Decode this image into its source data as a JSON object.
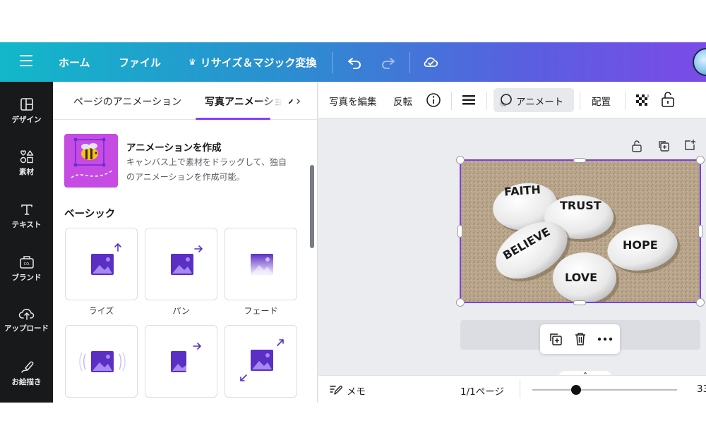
{
  "header": {
    "nav": {
      "home": "ホーム",
      "file": "ファイル",
      "resize": "リサイズ＆マジック変換"
    },
    "colors": {
      "gradient_start": "#12b8c9",
      "gradient_end": "#7b4be8"
    },
    "icons": [
      "menu-icon",
      "undo-icon",
      "redo-icon",
      "cloud-saved-icon",
      "crown-icon"
    ]
  },
  "rail": {
    "items": [
      {
        "label": "デザイン",
        "icon": "design-icon"
      },
      {
        "label": "素材",
        "icon": "elements-icon"
      },
      {
        "label": "テキスト",
        "icon": "text-icon"
      },
      {
        "label": "ブランド",
        "icon": "brand-icon"
      },
      {
        "label": "アップロード",
        "icon": "upload-icon"
      },
      {
        "label": "お絵描き",
        "icon": "draw-icon"
      }
    ]
  },
  "panel": {
    "tabs": [
      {
        "label": "ページのアニメーション"
      },
      {
        "label": "写真アニメーション"
      }
    ],
    "promo": {
      "title": "アニメーションを作成",
      "desc_line1": "キャンバス上で素材をドラッグして、独自",
      "desc_line2": "のアニメーションを作成可能。"
    },
    "section": "ベーシック",
    "cards": [
      {
        "label": "ライズ"
      },
      {
        "label": "パン"
      },
      {
        "label": "フェード"
      },
      {
        "label": ""
      },
      {
        "label": ""
      },
      {
        "label": ""
      }
    ]
  },
  "toolbar": {
    "edit_photo": "写真を編集",
    "flip": "反転",
    "animate": "アニメート",
    "position": "配置",
    "accent": "#8b3dff"
  },
  "canvas": {
    "stones": [
      "FAITH",
      "TRUST",
      "BELIEVE",
      "HOPE",
      "LOVE"
    ]
  },
  "footer": {
    "notes": "メモ",
    "page": "1/1ページ",
    "zoom": "33"
  }
}
